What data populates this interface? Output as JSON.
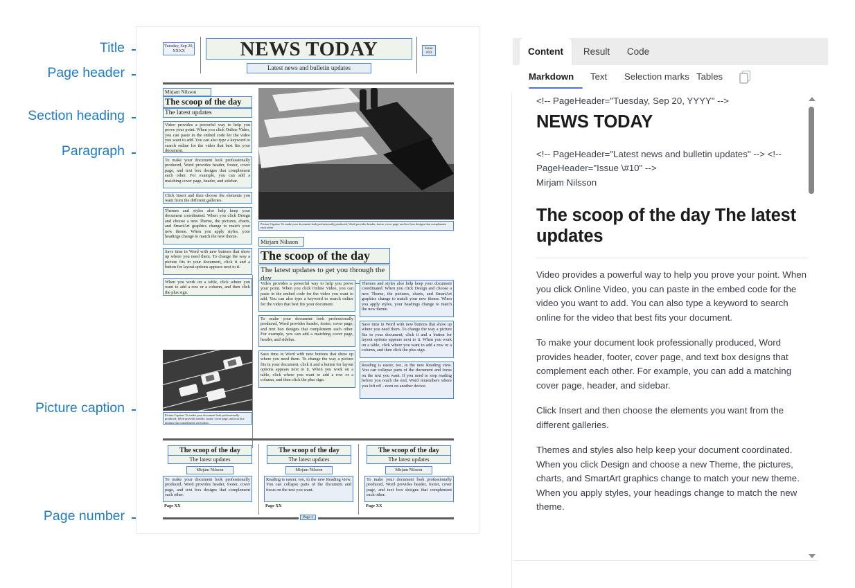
{
  "annotations": [
    {
      "id": "title",
      "label": "Title"
    },
    {
      "id": "page-header",
      "label": "Page header"
    },
    {
      "id": "section-heading",
      "label": "Section heading"
    },
    {
      "id": "paragraph",
      "label": "Paragraph"
    },
    {
      "id": "picture-caption",
      "label": "Picture caption"
    },
    {
      "id": "page-number",
      "label": "Page number"
    }
  ],
  "document": {
    "masthead": {
      "date": "Tuesday, Sep 20, XXXX",
      "title": "NEWS TODAY",
      "subtitle": "Latest news and bulletin updates",
      "issue": "Issue #10"
    },
    "section1": {
      "byline": "Mirjam Nilsson",
      "heading": "The scoop of the day",
      "subheading": "The latest updates",
      "paragraphs": [
        "Video provides a powerful way to help you prove your point. When you click Online Video, you can paste in the embed code for the video you want to add. You can also type a keyword to search online for the video that best fits your document.",
        "To make your document look professionally produced, Word provides header, footer, cover page, and text box designs that complement each other. For example, you can add a matching cover page, header, and sidebar.",
        "Click Insert and then choose the elements you want from the different galleries.",
        "Themes and styles also help keep your document coordinated. When you click Design and choose a new Theme, the pictures, charts, and SmartArt graphics change to match your new theme. When you apply styles, your headings change to match the new theme.",
        "Save time in Word with new buttons that show up where you need them. To change the way a picture fits in your document, click it and a button for layout options appears next to it.",
        "When you work on a table, click where you want to add a row or a column, and then click the plus sign."
      ],
      "picture_caption": "Picture Caption: To make your document look professionally produced, Word provides header, footer, cover page, and text box designs that complement each other"
    },
    "section2": {
      "byline": "Mirjam Nilsson",
      "heading": "The scoop of the day",
      "subheading": "The latest updates to get you through the day",
      "left_paragraphs": [
        "Video provides a powerful way to help you prove your point. When you click Online Video, you can paste in the embed code for the video you want to add. You can also type a keyword to search online for the video that best fits your document.",
        "To make your document look professionally produced, Word provides header, footer, cover page, and text box designs that complement each other. For example, you can add a matching cover page, header, and sidebar.",
        "Save time in Word with new buttons that show up where you need them. To change the way a picture fits in your document, click it and a button for layout options appears next to it. When you work on a table, click where you want to add a row or a column, and then click the plus sign."
      ],
      "right_paragraphs": [
        "Themes and styles also help keep your document coordinated. When you click Design and choose a new Theme, the pictures, charts, and SmartArt graphics change to match your new theme. When you apply styles, your headings change to match the new theme.",
        "Save time in Word with new buttons that show up where you need them. To change the way a picture fits in your document, click it and a button for layout options appears next to it. When you work on a table, click where you want to add a row or a column, and then click the plus sign.",
        "Reading is easier, too, in the new Reading view. You can collapse parts of the document and focus on the text you want. If you need to stop reading before you reach the end, Word remembers where you left off - even on another device."
      ],
      "picture_caption": "Picture Caption: To make your document look professionally produced, Word provides header, footer, cover page, and text box designs that complement each other."
    },
    "section3_columns": [
      {
        "heading": "The scoop of the day",
        "subheading": "The latest updates",
        "byline": "Mirjam Nilsson",
        "body": "To make your document look professionally produced, Word provides header, footer, cover page, and text box designs that complement each other.",
        "page_label": "Page XX"
      },
      {
        "heading": "The scoop of the day",
        "subheading": "The latest updates",
        "byline": "Mirjam Nilsson",
        "body": "Reading is easier, too, in the new Reading view. You can collapse parts of the document and focus on the text you want.",
        "page_label": "Page XX"
      },
      {
        "heading": "The scoop of the day",
        "subheading": "The latest updates",
        "byline": "Mirjam Nilsson",
        "body": "To make your document look professionally produced, Word provides header, footer, cover page, and text box designs that complement each other.",
        "page_label": "Page XX"
      }
    ],
    "footer_page_number": "Page 1"
  },
  "panel": {
    "tabs": [
      {
        "label": "Content",
        "active": true
      },
      {
        "label": "Result",
        "active": false
      },
      {
        "label": "Code",
        "active": false
      }
    ],
    "subtabs": [
      {
        "label": "Markdown",
        "active": true
      },
      {
        "label": "Text",
        "active": false
      },
      {
        "label": "Selection marks",
        "active": false
      },
      {
        "label": "Tables",
        "active": false
      }
    ],
    "copy_icon": "copy-icon",
    "markdown": {
      "comment_1": "<!-- PageHeader=\"Tuesday, Sep 20, YYYY\" -->",
      "h1_1": "NEWS TODAY",
      "comment_2": "<!-- PageHeader=\"Latest news and bulletin updates\" --> <!-- PageHeader=\"Issue \\#10\" -->",
      "byline": "Mirjam Nilsson",
      "h1_2": "The scoop of the day The latest updates",
      "paragraphs": [
        "Video provides a powerful way to help you prove your point. When you click Online Video, you can paste in the embed code for the video you want to add. You can also type a keyword to search online for the video that best fits your document.",
        "To make your document look professionally produced, Word provides header, footer, cover page, and text box designs that complement each other. For example, you can add a matching cover page, header, and sidebar.",
        "Click Insert and then choose the elements you want from the different galleries.",
        "Themes and styles also help keep your document coordinated. When you click Design and choose a new Theme, the pictures, charts, and SmartArt graphics change to match your new theme. When you apply styles, your headings change to match the new theme."
      ]
    }
  },
  "colors": {
    "annotation_blue": "#1E7BC8",
    "highlight_border": "#4a86d8",
    "subtab_underline": "#4F6BED",
    "tabstrip_bg": "#ececec"
  }
}
